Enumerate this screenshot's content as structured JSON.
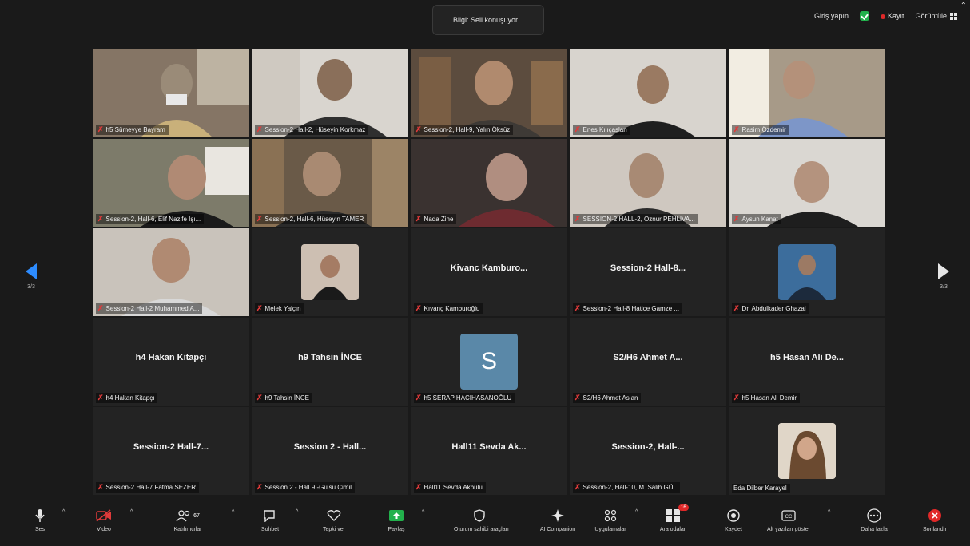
{
  "topbar": {
    "speaker_pill": "Bilgi: Seli konuşuyor...",
    "sign_in": "Giriş yapın",
    "record": "Kayıt",
    "view": "Görüntüle"
  },
  "tiles": [
    {
      "name": "h5 Sümeyye Bayram"
    },
    {
      "name": "Session-2 Hall-2, Hüseyin Korkmaz"
    },
    {
      "name": "Session-2, Hall-9, Yalın Öksüz"
    },
    {
      "name": "Enes Kılıçaslan"
    },
    {
      "name": "Rasim Özdemir"
    },
    {
      "name": "Session-2, Hall-6, Elif Nazife Işı..."
    },
    {
      "name": "Session-2, Hall-6, Hüseyin TAMER"
    },
    {
      "name": "Nada Zine"
    },
    {
      "name": "SESSION-2 HALL-2, Öznur PEHLİVA..."
    },
    {
      "name": "Aysun Kanat"
    },
    {
      "name": "Session-2 Hall-2 Muhammed A..."
    },
    {
      "name": "Melek Yalçın"
    },
    {
      "name": "Kıvanç Kamburoğlu",
      "big": "Kivanc Kamburo..."
    },
    {
      "name": "Session-2 Hall-8 Hatice Gamze ...",
      "big": "Session-2 Hall-8..."
    },
    {
      "name": "Dr. Abdulkader Ghazal"
    },
    {
      "name": "h4 Hakan Kitapçı",
      "big": "h4 Hakan Kitapçı"
    },
    {
      "name": "h9 Tahsin İNCE",
      "big": "h9 Tahsin İNCE"
    },
    {
      "name": "h5 SERAP HACIHASANOĞLU",
      "initial": "S"
    },
    {
      "name": "S2/H6 Ahmet Aslan",
      "big": "S2/H6 Ahmet A..."
    },
    {
      "name": "h5 Hasan Ali Demir",
      "big": "h5 Hasan Ali De..."
    },
    {
      "name": "Session-2 Hall-7 Fatma SEZER",
      "big": "Session-2 Hall-7..."
    },
    {
      "name": "Session 2 - Hall 9 -Gülsu Çimil",
      "big": "Session 2 - Hall..."
    },
    {
      "name": "Hall11 Sevda Akbulu",
      "big": "Hall11 Sevda Ak..."
    },
    {
      "name": "Session-2, Hall-10, M. Salih GÜL",
      "big": "Session-2, Hall-..."
    },
    {
      "name": "Eda Dilber Karayel"
    }
  ],
  "nav": {
    "left_page": "3/3",
    "right_page": "3/3"
  },
  "toolbar": {
    "mic": "Ses",
    "video": "Video",
    "participants": "Katılımcılar",
    "participants_count": "67",
    "chat": "Sohbet",
    "reactions": "Tepki ver",
    "share": "Paylaş",
    "host_tools": "Oturum sahibi araçları",
    "ai": "AI Companion",
    "apps": "Uygulamalar",
    "breakout": "Ara odalar",
    "breakout_badge": "16",
    "record": "Kaydet",
    "captions": "Alt yazıları göster",
    "more": "Daha fazla",
    "end": "Sonlandır"
  },
  "colors": {
    "accent": "#2d8cff",
    "danger": "#e02828",
    "tile_bg": "#232323"
  }
}
